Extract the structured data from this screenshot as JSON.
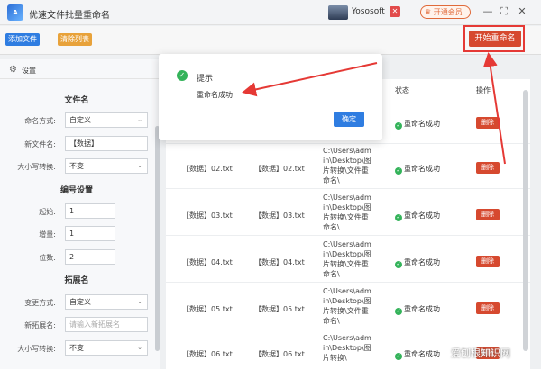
{
  "titlebar": {
    "logo_text": "A",
    "title": "优速文件批量重命名",
    "user_name": "Yososoft",
    "vip_label": "开通会员",
    "min_glyph": "—",
    "max_glyph": "⛶",
    "close_glyph": "✕"
  },
  "toolbar": {
    "add_files": "添加文件",
    "clear_list": "清除列表",
    "start_rename": "开始重命名"
  },
  "sidebar": {
    "header": "设置",
    "section_filename": "文件名",
    "naming_mode_label": "命名方式:",
    "naming_mode_value": "自定义",
    "new_name_label": "新文件名:",
    "new_name_value": "【数据】",
    "case_label": "大小写转换:",
    "case_value": "不变",
    "section_number": "编号设置",
    "start_label": "起始:",
    "start_value": "1",
    "increment_label": "增量:",
    "increment_value": "1",
    "digits_label": "位数:",
    "digits_value": "2",
    "section_ext": "拓展名",
    "ext_change_label": "变更方式:",
    "ext_change_value": "自定义",
    "new_ext_label": "新拓展名:",
    "new_ext_placeholder": "请输入新拓展名",
    "ext_case_label": "大小写转换:",
    "ext_case_value": "不变"
  },
  "table": {
    "col_status": "状态",
    "col_action": "操作",
    "rows": [
      {
        "old": "",
        "new": "",
        "path": "",
        "status": "重命名成功",
        "action": "删除"
      },
      {
        "old": "【数据】02.txt",
        "new": "【数据】02.txt",
        "path": "C:\\Users\\admin\\Desktop\\图片转换\\文件重命名\\",
        "status": "重命名成功",
        "action": "删除"
      },
      {
        "old": "【数据】03.txt",
        "new": "【数据】03.txt",
        "path": "C:\\Users\\admin\\Desktop\\图片转换\\文件重命名\\",
        "status": "重命名成功",
        "action": "删除"
      },
      {
        "old": "【数据】04.txt",
        "new": "【数据】04.txt",
        "path": "C:\\Users\\admin\\Desktop\\图片转换\\文件重命名\\",
        "status": "重命名成功",
        "action": "删除"
      },
      {
        "old": "【数据】05.txt",
        "new": "【数据】05.txt",
        "path": "C:\\Users\\admin\\Desktop\\图片转换\\文件重命名\\",
        "status": "重命名成功",
        "action": "删除"
      },
      {
        "old": "【数据】06.txt",
        "new": "【数据】06.txt",
        "path": "C:\\Users\\admin\\Desktop\\图片转换\\",
        "status": "重命名成功",
        "action": "删除"
      }
    ]
  },
  "modal": {
    "title": "提示",
    "message": "重命名成功",
    "ok": "确定"
  },
  "watermark": "爱刨根知识网",
  "colors": {
    "primary": "#2f7de1",
    "danger": "#d6492f",
    "success": "#34b35a",
    "annotation": "#e53935"
  }
}
